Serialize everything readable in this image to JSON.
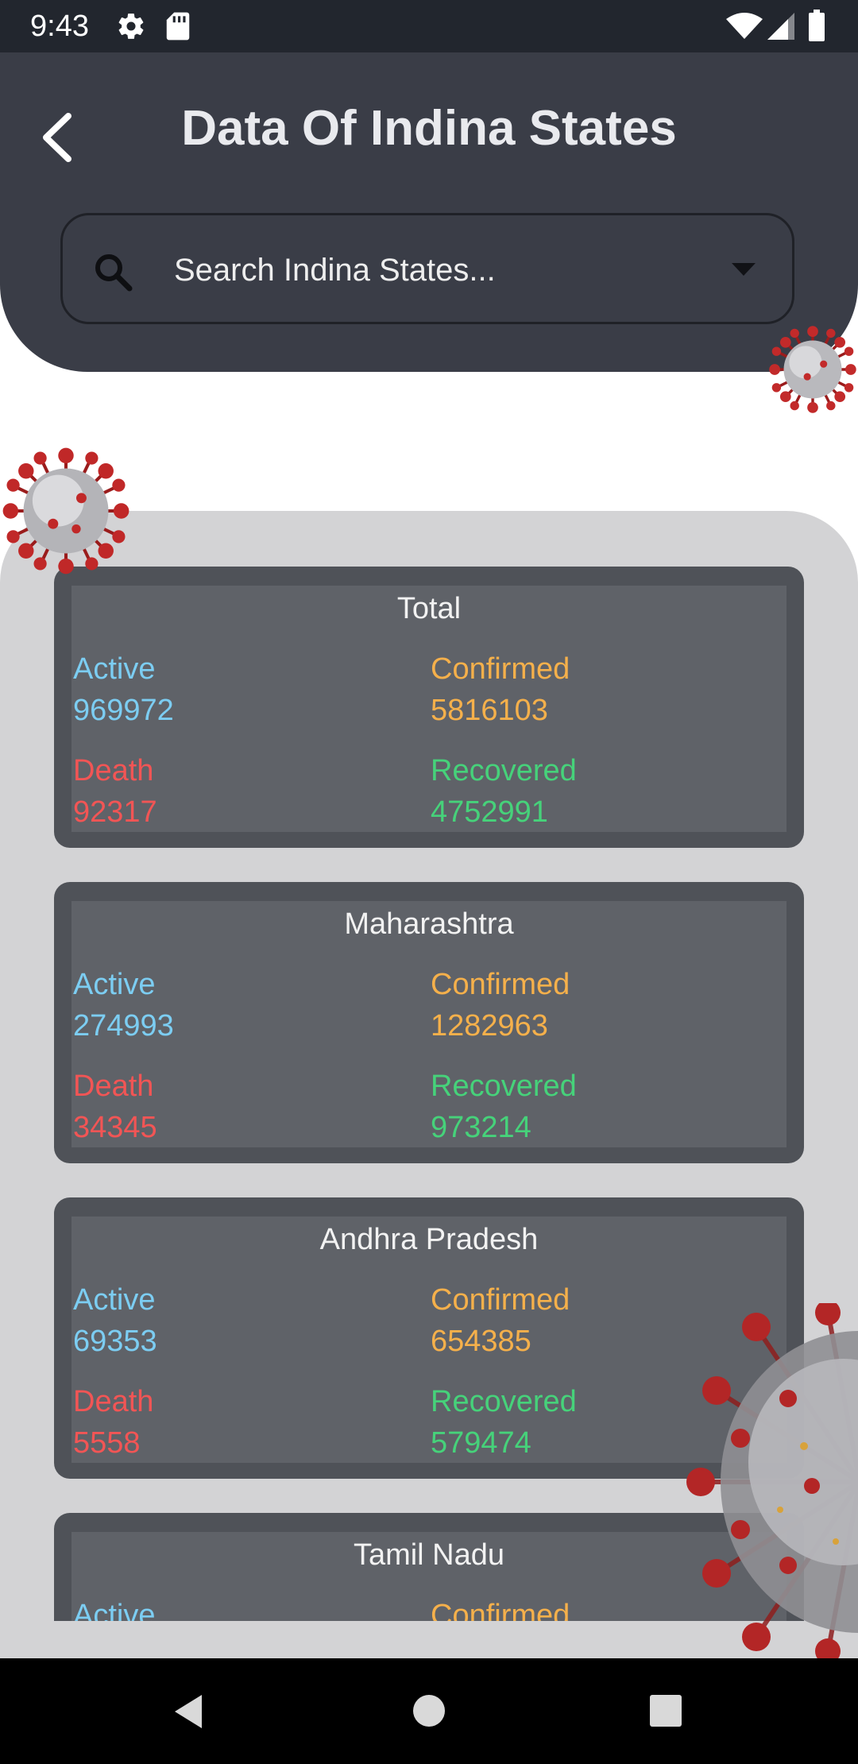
{
  "status_bar": {
    "time": "9:43",
    "icons": [
      "gear-icon",
      "sd-card-icon",
      "wifi-icon",
      "signal-icon",
      "battery-icon"
    ]
  },
  "header": {
    "title": "Data Of Indina States",
    "back_icon": "chevron-left-icon"
  },
  "search": {
    "placeholder": "Search Indina States...",
    "icon": "search-icon",
    "dropdown_icon": "caret-down-icon"
  },
  "labels": {
    "active": "Active",
    "confirmed": "Confirmed",
    "death": "Death",
    "recovered": "Recovered"
  },
  "cards": [
    {
      "name": "Total",
      "active": "969972",
      "confirmed": "5816103",
      "death": "92317",
      "recovered": "4752991"
    },
    {
      "name": "Maharashtra",
      "active": "274993",
      "confirmed": "1282963",
      "death": "34345",
      "recovered": "973214"
    },
    {
      "name": "Andhra Pradesh",
      "active": "69353",
      "confirmed": "654385",
      "death": "5558",
      "recovered": "579474"
    },
    {
      "name": "Tamil Nadu",
      "active": "",
      "confirmed": "",
      "death": "",
      "recovered": ""
    }
  ],
  "colors": {
    "header_bg": "#3a3d47",
    "panel_bg": "#d3d3d5",
    "card_bg": "#5f6268",
    "active": "#7ccdf2",
    "confirmed": "#f5b04b",
    "death": "#f25555",
    "recovered": "#46d27a"
  },
  "nav_bar": {
    "icons": [
      "back-triangle-icon",
      "home-circle-icon",
      "recents-square-icon"
    ]
  }
}
